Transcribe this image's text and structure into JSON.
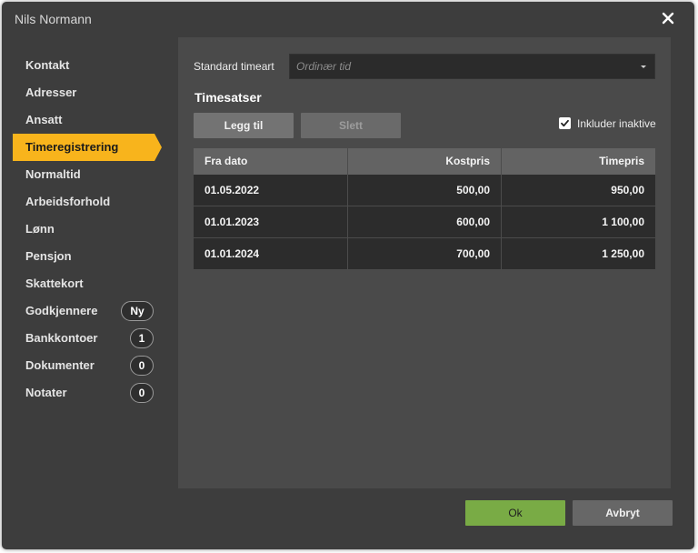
{
  "window": {
    "title": "Nils Normann"
  },
  "sidebar": {
    "items": [
      {
        "label": "Kontakt"
      },
      {
        "label": "Adresser"
      },
      {
        "label": "Ansatt"
      },
      {
        "label": "Timeregistrering"
      },
      {
        "label": "Normaltid"
      },
      {
        "label": "Arbeidsforhold"
      },
      {
        "label": "Lønn"
      },
      {
        "label": "Pensjon"
      },
      {
        "label": "Skattekort"
      },
      {
        "label": "Godkjennere",
        "badge": "Ny"
      },
      {
        "label": "Bankkontoer",
        "badge": "1"
      },
      {
        "label": "Dokumenter",
        "badge": "0"
      },
      {
        "label": "Notater",
        "badge": "0"
      }
    ],
    "active": "Timeregistrering"
  },
  "form": {
    "standard_label": "Standard timeart",
    "standard_placeholder": "Ordinær tid"
  },
  "rates": {
    "title": "Timesatser",
    "add_label": "Legg til",
    "delete_label": "Slett",
    "include_inactive_label": "Inkluder inaktive",
    "include_inactive_checked": true
  },
  "table": {
    "headers": [
      "Fra dato",
      "Kostpris",
      "Timepris"
    ],
    "rows": [
      [
        "01.05.2022",
        "500,00",
        "950,00"
      ],
      [
        "01.01.2023",
        "600,00",
        "1 100,00"
      ],
      [
        "01.01.2024",
        "700,00",
        "1 250,00"
      ]
    ]
  },
  "footer": {
    "ok_label": "Ok",
    "cancel_label": "Avbryt"
  },
  "colors": {
    "accent": "#f8b41c",
    "ok": "#79ab45",
    "background": "#3d3d3d"
  }
}
